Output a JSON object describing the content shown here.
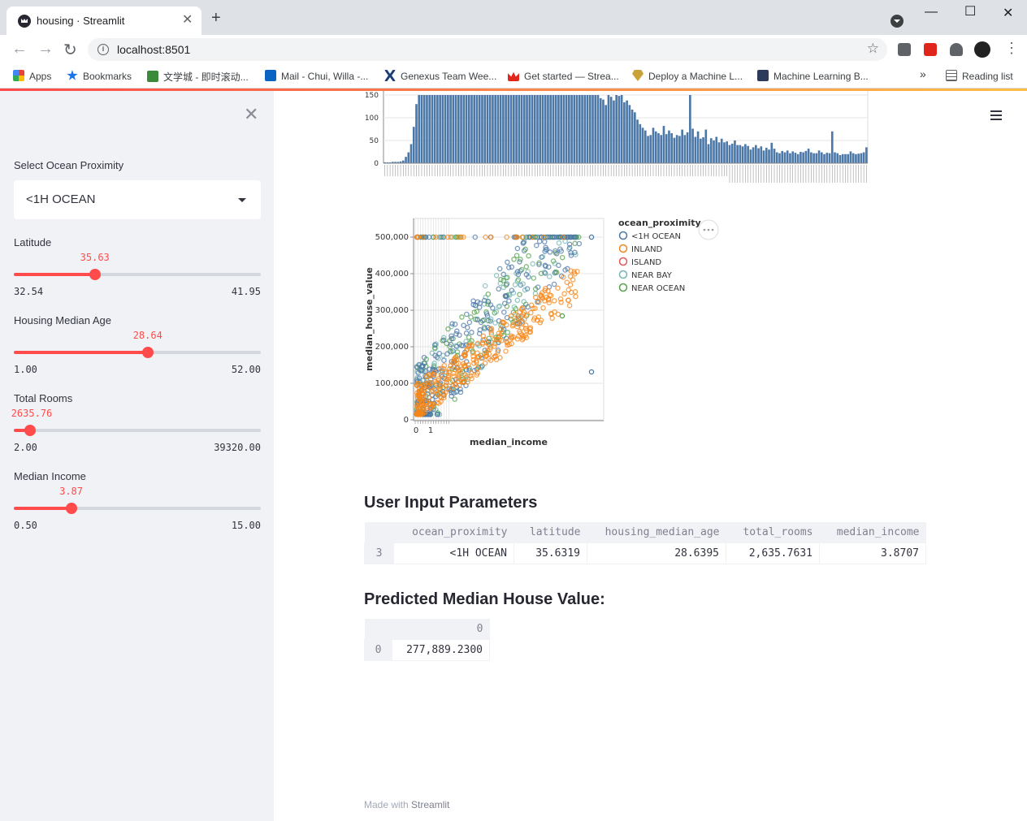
{
  "browser": {
    "tab_title": "housing · Streamlit",
    "url": "localhost:8501",
    "bookmarks": [
      "Apps",
      "Bookmarks",
      "文学城 - 即时滚动...",
      "Mail - Chui, Willa -...",
      "Genexus Team Wee...",
      "Get started — Strea...",
      "Deploy a Machine L...",
      "Machine Learning B...",
      "»",
      "Reading list"
    ]
  },
  "sidebar": {
    "select_label": "Select Ocean Proximity",
    "select_value": "<1H OCEAN",
    "sliders": [
      {
        "label": "Latitude",
        "value": "35.63",
        "min": "32.54",
        "max": "41.95",
        "fraction": 0.328
      },
      {
        "label": "Housing Median Age",
        "value": "28.64",
        "min": "1.00",
        "max": "52.00",
        "fraction": 0.542
      },
      {
        "label": "Total Rooms",
        "value": "2635.76",
        "min": "2.00",
        "max": "39320.00",
        "fraction": 0.067
      },
      {
        "label": "Median Income",
        "value": "3.87",
        "min": "0.50",
        "max": "15.00",
        "fraction": 0.232
      }
    ]
  },
  "main": {
    "section_params": "User Input Parameters",
    "params_table": {
      "columns": [
        "",
        "ocean_proximity",
        "latitude",
        "housing_median_age",
        "total_rooms",
        "median_income"
      ],
      "rows": [
        [
          "3",
          "<1H OCEAN",
          "35.6319",
          "28.6395",
          "2,635.7631",
          "3.8707"
        ]
      ]
    },
    "section_pred": "Predicted Median House Value:",
    "pred_table": {
      "columns": [
        "",
        "0"
      ],
      "rows": [
        [
          "0",
          "277,889.2300"
        ]
      ]
    },
    "footer_prefix": "Made with ",
    "footer_brand": "Streamlit"
  },
  "chart_data": [
    {
      "type": "bar",
      "title": "",
      "y_ticks": [
        "150",
        "100",
        "50",
        "0"
      ],
      "ylim": [
        0,
        150
      ],
      "values": [
        2,
        2,
        2,
        3,
        3,
        3,
        4,
        6,
        14,
        24,
        42,
        80,
        130,
        150,
        150,
        150,
        150,
        150,
        150,
        150,
        150,
        150,
        150,
        150,
        150,
        150,
        150,
        150,
        150,
        150,
        150,
        150,
        150,
        150,
        150,
        150,
        150,
        150,
        150,
        150,
        150,
        150,
        150,
        150,
        150,
        150,
        150,
        150,
        150,
        150,
        150,
        150,
        150,
        150,
        150,
        150,
        150,
        150,
        150,
        150,
        150,
        150,
        150,
        150,
        150,
        150,
        150,
        150,
        150,
        150,
        150,
        150,
        150,
        150,
        150,
        150,
        150,
        150,
        150,
        150,
        150,
        150,
        143,
        140,
        128,
        150,
        146,
        138,
        150,
        148,
        150,
        134,
        138,
        128,
        118,
        112,
        96,
        86,
        78,
        72,
        60,
        62,
        78,
        70,
        66,
        62,
        82,
        64,
        72,
        66,
        56,
        62,
        60,
        74,
        62,
        68,
        150,
        76,
        58,
        70,
        54,
        57,
        74,
        42,
        55,
        50,
        58,
        46,
        54,
        46,
        48,
        40,
        43,
        50,
        40,
        40,
        37,
        42,
        38,
        30,
        35,
        40,
        33,
        37,
        28,
        34,
        30,
        45,
        32,
        24,
        22,
        27,
        24,
        28,
        22,
        26,
        23,
        20,
        25,
        24,
        27,
        32,
        24,
        22,
        22,
        28,
        24,
        20,
        23,
        22,
        70,
        24,
        22,
        18,
        20,
        20,
        20,
        26,
        22,
        20,
        21,
        22,
        24,
        35
      ]
    },
    {
      "type": "scatter",
      "xlabel": "median_income",
      "ylabel": "median_house_value",
      "x_ticks": [
        "0",
        "1"
      ],
      "y_ticks": [
        "500,000",
        "400,000",
        "300,000",
        "200,000",
        "100,000",
        "0"
      ],
      "ylim": [
        0,
        500000
      ],
      "legend_title": "ocean_proximity",
      "legend": [
        {
          "name": "<1H OCEAN",
          "color": "#4c78a8"
        },
        {
          "name": "INLAND",
          "color": "#f58518"
        },
        {
          "name": "ISLAND",
          "color": "#e45756"
        },
        {
          "name": "NEAR BAY",
          "color": "#72b7b2"
        },
        {
          "name": "NEAR OCEAN",
          "color": "#54a24b"
        }
      ],
      "legend_placement": "right"
    }
  ]
}
